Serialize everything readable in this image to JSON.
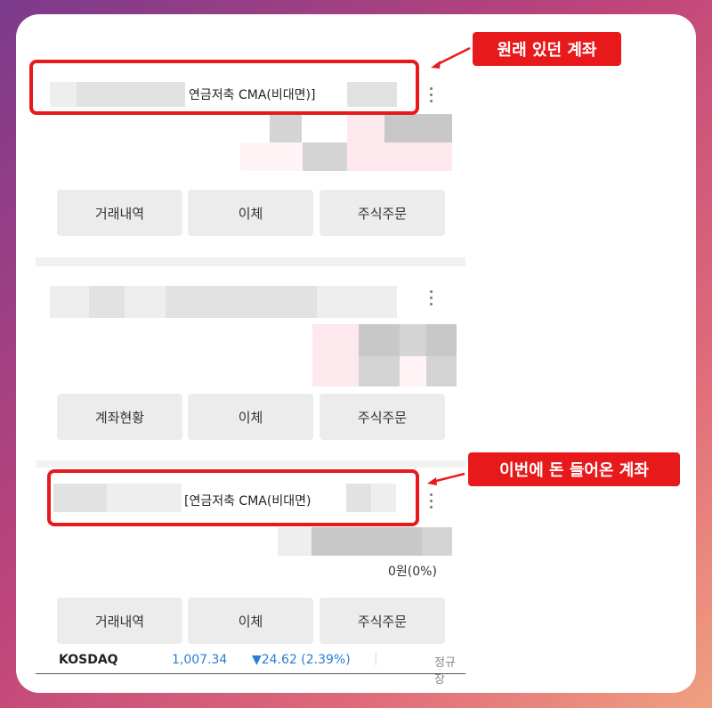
{
  "accounts": [
    {
      "name": "연금저축 CMA(비대면)]",
      "buttons": [
        "거래내역",
        "이체",
        "주식주문"
      ]
    },
    {
      "name": "",
      "buttons": [
        "계좌현황",
        "이체",
        "주식주문"
      ]
    },
    {
      "name": "[연금저축 CMA(비대면)",
      "balance": "0원(0%)",
      "buttons": [
        "거래내역",
        "이체",
        "주식주문"
      ]
    }
  ],
  "callouts": {
    "original": "원래 있던 계좌",
    "received": "이번에 돈 들어온 계좌"
  },
  "ticker": {
    "name": "KOSDAQ",
    "value": "1,007.34",
    "change": "▼24.62 (2.39%)",
    "separator": "|",
    "status": "정규장"
  },
  "icons": [
    "kebab-menu-icon",
    "arrow-icon"
  ],
  "colors": {
    "highlight": "#e8191b",
    "ticker_blue": "#2a7dd6"
  }
}
